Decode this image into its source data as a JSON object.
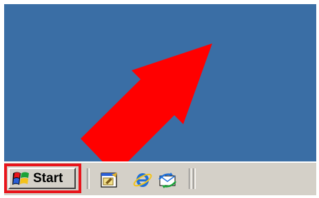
{
  "taskbar": {
    "start_label": "Start",
    "quick_launch": [
      {
        "name": "show-desktop-icon"
      },
      {
        "name": "internet-explorer-icon"
      },
      {
        "name": "outlook-express-icon"
      }
    ]
  },
  "colors": {
    "desktop": "#3a6ea5",
    "taskbar": "#d4d0c8",
    "highlight": "#e8141b",
    "arrow": "#ff0000"
  }
}
